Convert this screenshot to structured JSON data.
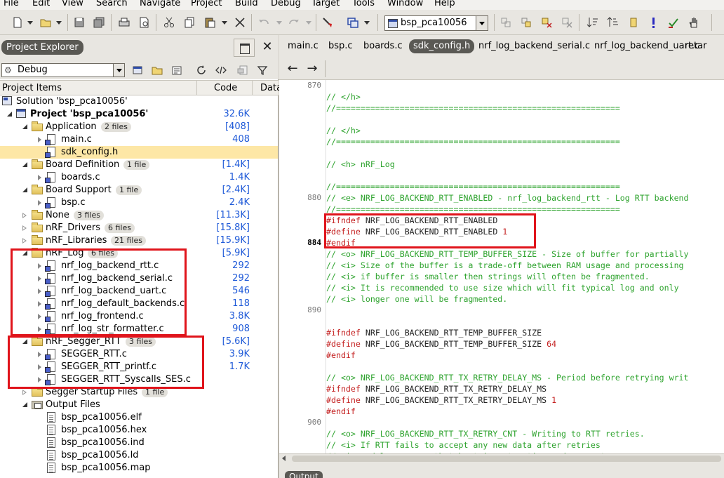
{
  "menu": [
    "File",
    "Edit",
    "View",
    "Search",
    "Navigate",
    "Project",
    "Build",
    "Debug",
    "Target",
    "Tools",
    "Window",
    "Help"
  ],
  "toolbar": {
    "config_value": "bsp_pca10056"
  },
  "project_explorer": {
    "title": "Project Explorer",
    "config": "Debug",
    "columns": [
      "Project Items",
      "Code",
      "Data"
    ],
    "tree": [
      {
        "label": "Solution 'bsp_pca10056'",
        "badge": "",
        "code": "",
        "indent": 0,
        "icon": "solution",
        "expander": "none",
        "bold": false
      },
      {
        "label": "Project 'bsp_pca10056'",
        "badge": "",
        "code": "32.6K",
        "indent": 1,
        "icon": "project",
        "expander": "open",
        "bold": true
      },
      {
        "label": "Application",
        "badge": "2 files",
        "code": "[408]",
        "indent": 2,
        "icon": "folder",
        "expander": "open",
        "bold": false
      },
      {
        "label": "main.c",
        "badge": "",
        "code": "408",
        "indent": 3,
        "icon": "file-c",
        "expander": "closed",
        "bold": false
      },
      {
        "label": "sdk_config.h",
        "badge": "",
        "code": "",
        "indent": 3,
        "icon": "file-c",
        "expander": "none",
        "bold": false,
        "selected": true
      },
      {
        "label": "Board Definition",
        "badge": "1 file",
        "code": "[1.4K]",
        "indent": 2,
        "icon": "folder",
        "expander": "open",
        "bold": false
      },
      {
        "label": "boards.c",
        "badge": "",
        "code": "1.4K",
        "indent": 3,
        "icon": "file-c",
        "expander": "closed",
        "bold": false
      },
      {
        "label": "Board Support",
        "badge": "1 file",
        "code": "[2.4K]",
        "indent": 2,
        "icon": "folder",
        "expander": "open",
        "bold": false
      },
      {
        "label": "bsp.c",
        "badge": "",
        "code": "2.4K",
        "indent": 3,
        "icon": "file-c",
        "expander": "closed",
        "bold": false
      },
      {
        "label": "None",
        "badge": "3 files",
        "code": "[11.3K]",
        "indent": 2,
        "icon": "folder",
        "expander": "closed-o",
        "bold": false
      },
      {
        "label": "nRF_Drivers",
        "badge": "6 files",
        "code": "[15.8K]",
        "indent": 2,
        "icon": "folder",
        "expander": "closed-o",
        "bold": false
      },
      {
        "label": "nRF_Libraries",
        "badge": "21 files",
        "code": "[15.9K]",
        "indent": 2,
        "icon": "folder",
        "expander": "closed-o",
        "bold": false
      },
      {
        "label": "nRF_Log",
        "badge": "6 files",
        "code": "[5.9K]",
        "indent": 2,
        "icon": "folder",
        "expander": "open",
        "bold": false
      },
      {
        "label": "nrf_log_backend_rtt.c",
        "badge": "",
        "code": "292",
        "indent": 3,
        "icon": "file-c",
        "expander": "closed",
        "bold": false
      },
      {
        "label": "nrf_log_backend_serial.c",
        "badge": "",
        "code": "292",
        "indent": 3,
        "icon": "file-c",
        "expander": "closed",
        "bold": false
      },
      {
        "label": "nrf_log_backend_uart.c",
        "badge": "",
        "code": "546",
        "indent": 3,
        "icon": "file-c",
        "expander": "closed",
        "bold": false
      },
      {
        "label": "nrf_log_default_backends.c",
        "badge": "",
        "code": "118",
        "indent": 3,
        "icon": "file-c",
        "expander": "closed",
        "bold": false
      },
      {
        "label": "nrf_log_frontend.c",
        "badge": "",
        "code": "3.8K",
        "indent": 3,
        "icon": "file-c",
        "expander": "closed",
        "bold": false
      },
      {
        "label": "nrf_log_str_formatter.c",
        "badge": "",
        "code": "908",
        "indent": 3,
        "icon": "file-c",
        "expander": "closed",
        "bold": false
      },
      {
        "label": "nRF_Segger_RTT",
        "badge": "3 files",
        "code": "[5.6K]",
        "indent": 2,
        "icon": "folder",
        "expander": "open",
        "bold": false
      },
      {
        "label": "SEGGER_RTT.c",
        "badge": "",
        "code": "3.9K",
        "indent": 3,
        "icon": "file-c",
        "expander": "closed",
        "bold": false
      },
      {
        "label": "SEGGER_RTT_printf.c",
        "badge": "",
        "code": "1.7K",
        "indent": 3,
        "icon": "file-c",
        "expander": "closed",
        "bold": false
      },
      {
        "label": "SEGGER_RTT_Syscalls_SES.c",
        "badge": "",
        "code": "",
        "indent": 3,
        "icon": "file-c",
        "expander": "closed",
        "bold": false
      },
      {
        "label": "Segger Startup Files",
        "badge": "1 file",
        "code": "",
        "indent": 2,
        "icon": "folder",
        "expander": "closed-o",
        "bold": false
      },
      {
        "label": "Output Files",
        "badge": "",
        "code": "",
        "indent": 2,
        "icon": "output",
        "expander": "open",
        "bold": false
      },
      {
        "label": "bsp_pca10056.elf",
        "badge": "",
        "code": "",
        "indent": 3,
        "icon": "file-plain",
        "expander": "none",
        "bold": false
      },
      {
        "label": "bsp_pca10056.hex",
        "badge": "",
        "code": "",
        "indent": 3,
        "icon": "file-plain",
        "expander": "none",
        "bold": false
      },
      {
        "label": "bsp_pca10056.ind",
        "badge": "",
        "code": "",
        "indent": 3,
        "icon": "file-plain",
        "expander": "none",
        "bold": false
      },
      {
        "label": "bsp_pca10056.ld",
        "badge": "",
        "code": "",
        "indent": 3,
        "icon": "file-plain",
        "expander": "none",
        "bold": false
      },
      {
        "label": "bsp_pca10056.map",
        "badge": "",
        "code": "",
        "indent": 3,
        "icon": "file-plain",
        "expander": "none",
        "bold": false
      }
    ]
  },
  "editor": {
    "tabs": [
      "main.c",
      "bsp.c",
      "boards.c",
      "sdk_config.h",
      "nrf_log_backend_serial.c",
      "nrf_log_backend_uart.c",
      "retar"
    ],
    "active_tab": "sdk_config.h",
    "line_numbers": [
      {
        "line": 0,
        "label": "870",
        "current": false
      },
      {
        "line": 10,
        "label": "880",
        "current": false
      },
      {
        "line": 14,
        "label": "884",
        "current": true
      },
      {
        "line": 20,
        "label": "890",
        "current": false
      },
      {
        "line": 30,
        "label": "900",
        "current": false
      }
    ],
    "code_lines": [
      [],
      [
        {
          "c": "cm",
          "t": "// </h>"
        }
      ],
      [
        {
          "c": "cm",
          "t": "//=========================================================="
        }
      ],
      [],
      [
        {
          "c": "cm",
          "t": "// </h>"
        }
      ],
      [
        {
          "c": "cm",
          "t": "//=========================================================="
        }
      ],
      [],
      [
        {
          "c": "cm",
          "t": "// <h> nRF_Log"
        }
      ],
      [],
      [
        {
          "c": "cm",
          "t": "//=========================================================="
        }
      ],
      [
        {
          "c": "cm",
          "t": "// <e> NRF_LOG_BACKEND_RTT_ENABLED - nrf_log_backend_rtt - Log RTT backend"
        }
      ],
      [
        {
          "c": "cm",
          "t": "//=========================================================="
        }
      ],
      [
        {
          "c": "pp",
          "t": "#ifndef"
        },
        {
          "c": "tx",
          "t": " NRF_LOG_BACKEND_RTT_ENABLED"
        }
      ],
      [
        {
          "c": "pp",
          "t": "#define"
        },
        {
          "c": "tx",
          "t": " NRF_LOG_BACKEND_RTT_ENABLED "
        },
        {
          "c": "num",
          "t": "1"
        }
      ],
      [
        {
          "c": "pp",
          "t": "#endif"
        }
      ],
      [
        {
          "c": "cm",
          "t": "// <o> NRF_LOG_BACKEND_RTT_TEMP_BUFFER_SIZE - Size of buffer for partially"
        }
      ],
      [
        {
          "c": "cm",
          "t": "// <i> Size of the buffer is a trade-off between RAM usage and processing"
        }
      ],
      [
        {
          "c": "cm",
          "t": "// <i> if buffer is smaller then strings will often be fragmented."
        }
      ],
      [
        {
          "c": "cm",
          "t": "// <i> It is recommended to use size which will fit typical log and only"
        }
      ],
      [
        {
          "c": "cm",
          "t": "// <i> longer one will be fragmented."
        }
      ],
      [],
      [],
      [
        {
          "c": "pp",
          "t": "#ifndef"
        },
        {
          "c": "tx",
          "t": " NRF_LOG_BACKEND_RTT_TEMP_BUFFER_SIZE"
        }
      ],
      [
        {
          "c": "pp",
          "t": "#define"
        },
        {
          "c": "tx",
          "t": " NRF_LOG_BACKEND_RTT_TEMP_BUFFER_SIZE "
        },
        {
          "c": "num",
          "t": "64"
        }
      ],
      [
        {
          "c": "pp",
          "t": "#endif"
        }
      ],
      [],
      [
        {
          "c": "cm",
          "t": "// <o> NRF_LOG_BACKEND_RTT_TX_RETRY_DELAY_MS - Period before retrying writ"
        }
      ],
      [
        {
          "c": "pp",
          "t": "#ifndef"
        },
        {
          "c": "tx",
          "t": " NRF_LOG_BACKEND_RTT_TX_RETRY_DELAY_MS"
        }
      ],
      [
        {
          "c": "pp",
          "t": "#define"
        },
        {
          "c": "tx",
          "t": " NRF_LOG_BACKEND_RTT_TX_RETRY_DELAY_MS "
        },
        {
          "c": "num",
          "t": "1"
        }
      ],
      [
        {
          "c": "pp",
          "t": "#endif"
        }
      ],
      [],
      [
        {
          "c": "cm",
          "t": "// <o> NRF_LOG_BACKEND_RTT_TX_RETRY_CNT - Writing to RTT retries."
        }
      ],
      [
        {
          "c": "cm",
          "t": "// <i> If RTT fails to accept any new data after retries"
        }
      ],
      [
        {
          "c": "cm",
          "t": "// <i> module assumes that host is not active and on next"
        }
      ]
    ]
  },
  "bottom": {
    "output_tab": "Output"
  },
  "colors": {
    "highlight_box": "#e0141b",
    "selection": "#fde7a6",
    "code_value": "#1f5ad8",
    "comment": "#2ea32e",
    "preprocessor": "#c42020"
  }
}
